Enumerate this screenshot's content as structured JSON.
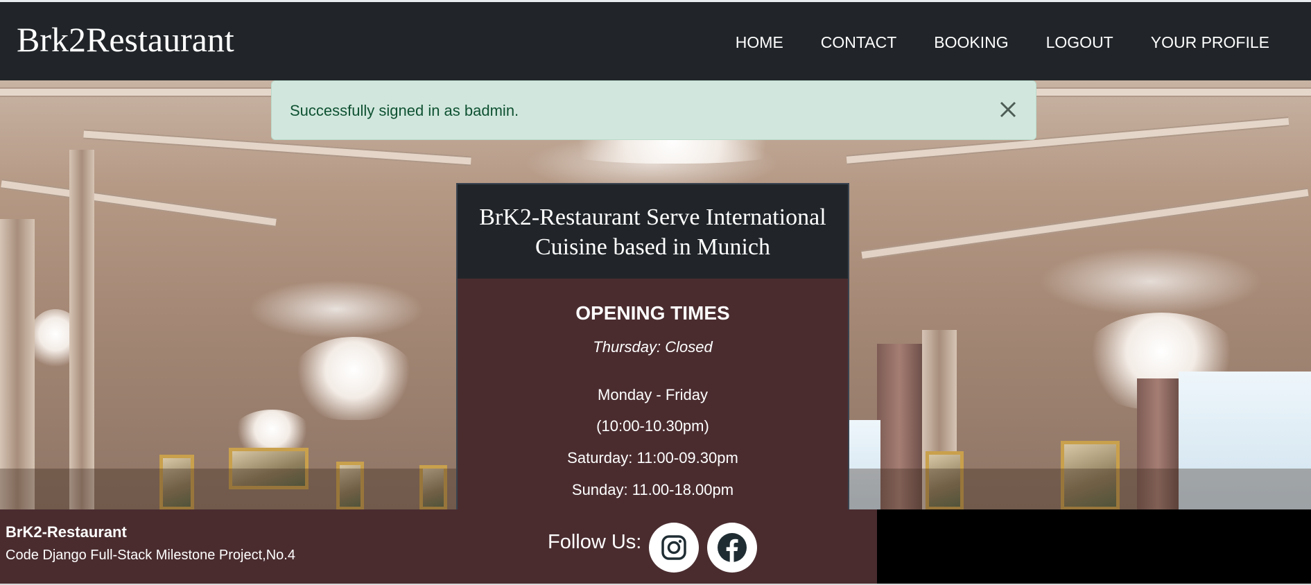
{
  "navbar": {
    "brand": "Brk2Restaurant",
    "links": [
      {
        "label": "HOME"
      },
      {
        "label": "CONTACT"
      },
      {
        "label": "BOOKING"
      },
      {
        "label": "LOGOUT"
      },
      {
        "label": "YOUR PROFILE"
      }
    ]
  },
  "alert": {
    "message": "Successfully signed in as badmin.",
    "close_icon": "close-icon",
    "color": "#d1e7dd"
  },
  "card": {
    "heading": "BrK2-Restaurant Serve International Cuisine based in Munich",
    "opening_title": "OPENING TIMES",
    "closed_day": "Thursday: Closed",
    "weekday_days": "Monday - Friday",
    "weekday_hours": "(10:00-10.30pm)",
    "saturday": "Saturday: 11:00-09.30pm",
    "sunday": "Sunday: 11.00-18.00pm"
  },
  "footer": {
    "title": "BrK2-Restaurant",
    "subtitle": "Code Django Full-Stack Milestone Project,No.4",
    "follow_label": "Follow Us:",
    "social_icons": [
      "instagram-icon",
      "facebook-icon"
    ]
  },
  "colors": {
    "navbar": "#212529",
    "card_body": "#4a2c2f",
    "footer": "#4a2c2f",
    "alert_text": "#0f5132"
  }
}
